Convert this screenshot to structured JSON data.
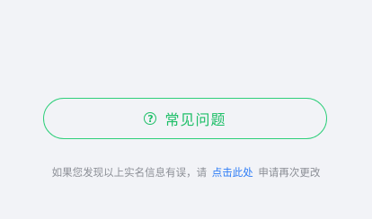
{
  "faq": {
    "icon": "question-circle-icon",
    "icon_glyph": "?",
    "label": "常见问题",
    "color": "#1fbf68"
  },
  "hint": {
    "prefix": "如果您发现以上实名信息有误，请",
    "link_text": "点击此处",
    "suffix": "申请再次更改",
    "link_color": "#2f7df6"
  }
}
